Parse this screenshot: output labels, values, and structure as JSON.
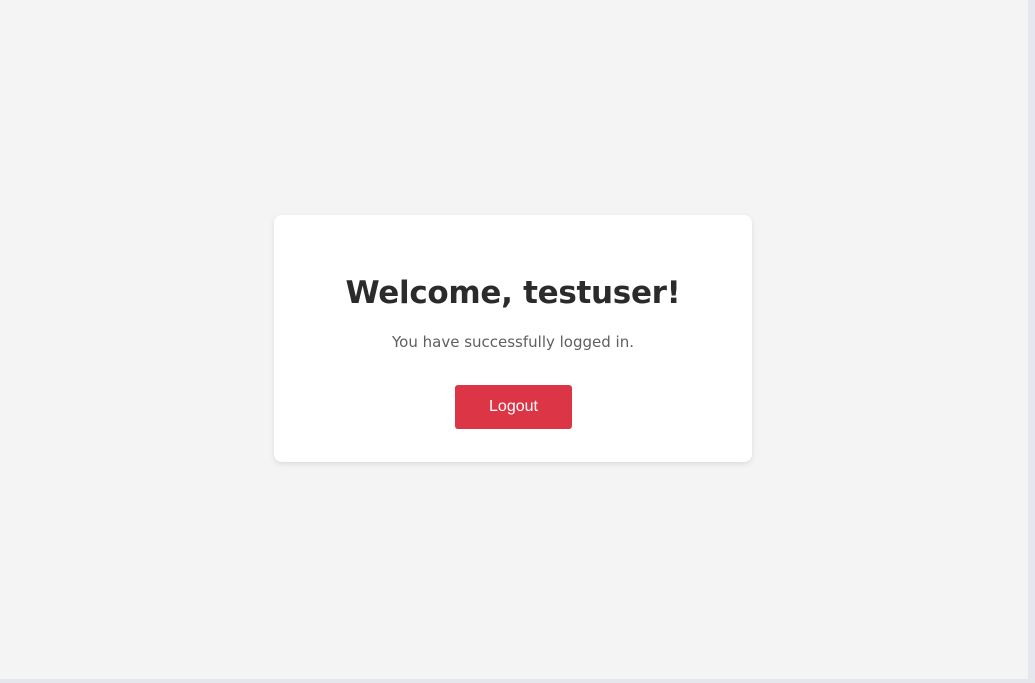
{
  "card": {
    "title": "Welcome, testuser!",
    "subtitle": "You have successfully logged in.",
    "logout_label": "Logout"
  },
  "colors": {
    "page_background": "#f4f4f4",
    "card_background": "#ffffff",
    "logout_button": "#dc3545"
  }
}
